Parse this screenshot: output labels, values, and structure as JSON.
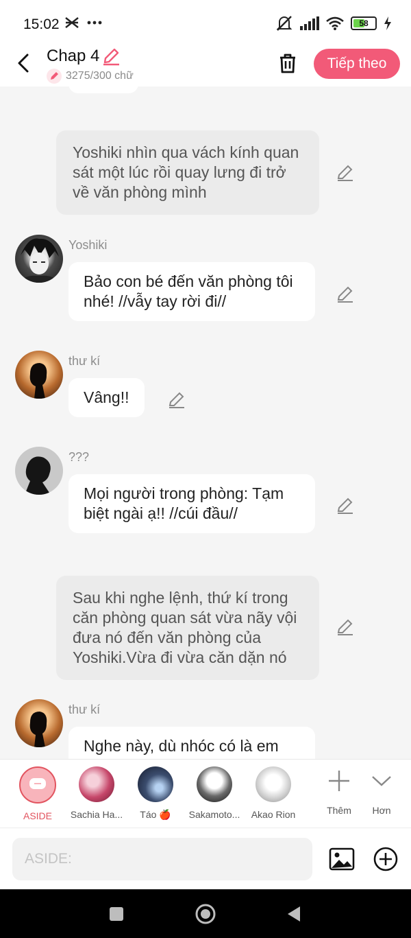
{
  "status": {
    "time": "15:02",
    "battery": "58",
    "battery_level": 0.58,
    "icons": [
      "notification-icon",
      "more-dots-icon",
      "mute-icon",
      "signal-icon",
      "wifi-icon",
      "battery-icon",
      "charging-icon"
    ]
  },
  "header": {
    "title": "Chap 4",
    "word_count": "3275/300 chữ",
    "next_label": "Tiếp theo",
    "accent_color": "#f25a78"
  },
  "messages": [
    {
      "type": "narration",
      "text": "Yoshiki nhìn qua vách kính quan sát một lúc rồi quay lưng đi trở về văn phòng mình"
    },
    {
      "type": "dialogue",
      "speaker": "Yoshiki",
      "text": "Bảo con bé đến văn phòng tôi nhé! //vẫy tay rời đi//"
    },
    {
      "type": "dialogue",
      "speaker": "thư kí",
      "text": "Vâng!!"
    },
    {
      "type": "dialogue",
      "speaker": "???",
      "text": "Mọi người trong phòng: Tạm biệt ngài ạ!! //cúi đầu//"
    },
    {
      "type": "narration",
      "text": "Sau khi nghe lệnh, thứ kí trong căn phòng quan sát vừa nãy vội đưa nó đến văn phòng của Yoshiki.Vừa đi vừa căn dặn nó"
    },
    {
      "type": "dialogue",
      "speaker": "thư kí",
      "text": "Nghe này, dù nhóc có là em"
    }
  ],
  "characters": [
    {
      "name": "ASIDE",
      "active": true
    },
    {
      "name": "Sachia Ha..."
    },
    {
      "name": "Táo 🍎"
    },
    {
      "name": "Sakamoto..."
    },
    {
      "name": "Akao Rion"
    },
    {
      "name": "Thêm"
    },
    {
      "name": "Hơn"
    }
  ],
  "composer": {
    "placeholder": "ASIDE:"
  }
}
